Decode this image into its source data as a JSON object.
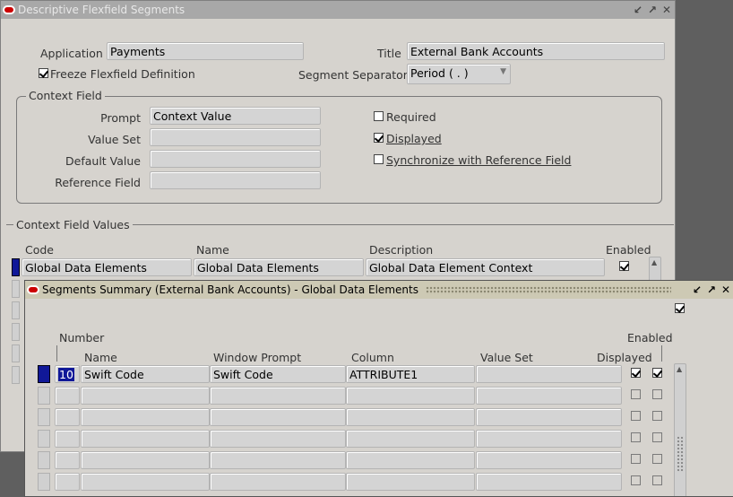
{
  "back_window": {
    "title": "Descriptive Flexfield Segments",
    "application_label": "Application",
    "application_value": "Payments",
    "title_label": "Title",
    "title_value": "External Bank Accounts",
    "freeze_label": "Freeze Flexfield Definition",
    "separator_label": "Segment Separator",
    "separator_value": "Period ( . )",
    "context_field": {
      "group_label": "Context Field",
      "prompt_label": "Prompt",
      "prompt_value": "Context Value",
      "value_set_label": "Value Set",
      "default_value_label": "Default Value",
      "reference_field_label": "Reference Field",
      "required_label": "Required",
      "displayed_label": "Displayed",
      "sync_label": "Synchronize with Reference Field"
    },
    "context_values": {
      "section_label": "Context Field Values",
      "col_code": "Code",
      "col_name": "Name",
      "col_description": "Description",
      "col_enabled": "Enabled",
      "rows": [
        {
          "code": "Global Data Elements",
          "name": "Global Data Elements",
          "description": "Global Data Element Context"
        }
      ]
    }
  },
  "front_window": {
    "title": "Segments Summary (External Bank Accounts) - Global Data Elements",
    "col_number": "Number",
    "col_name": "Name",
    "col_window_prompt": "Window Prompt",
    "col_column": "Column",
    "col_value_set": "Value Set",
    "col_displayed": "Displayed",
    "col_enabled": "Enabled",
    "rows": [
      {
        "number": "10",
        "name": "Swift Code",
        "window_prompt": "Swift Code",
        "column": "ATTRIBUTE1",
        "value_set": ""
      }
    ]
  },
  "colors": {
    "title_active": "#cdc9b4",
    "title_inactive": "#a8a8a8",
    "selection": "#101898"
  }
}
